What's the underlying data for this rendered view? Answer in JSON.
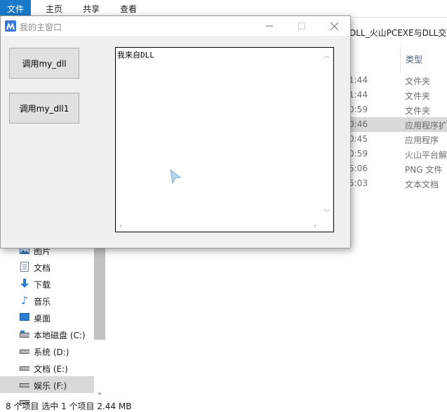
{
  "explorer": {
    "ribbon_tabs": [
      "文件",
      "主页",
      "共享",
      "查看"
    ],
    "address_text": "DLL_火山PCEXE与DLL交互",
    "column_header": "类型",
    "files": [
      {
        "time": "1:44",
        "type": "文件夹"
      },
      {
        "time": "1:44",
        "type": "文件夹"
      },
      {
        "time": "0:59",
        "type": "文件夹"
      },
      {
        "time": "0:46",
        "type": "应用程序扩",
        "selected": true
      },
      {
        "time": "0:45",
        "type": "应用程序"
      },
      {
        "time": "0:59",
        "type": "火山平台解"
      },
      {
        "time": "5:06",
        "type": "PNG 文件"
      },
      {
        "time": "5:03",
        "type": "文本文档"
      }
    ],
    "nav_items": [
      {
        "label": "图片",
        "icon": "pictures-icon"
      },
      {
        "label": "文档",
        "icon": "documents-icon"
      },
      {
        "label": "下载",
        "icon": "download-icon"
      },
      {
        "label": "音乐",
        "icon": "music-icon"
      },
      {
        "label": "桌面",
        "icon": "desktop-icon"
      },
      {
        "label": "本地磁盘 (C:)",
        "icon": "drive-icon"
      },
      {
        "label": "系统 (D:)",
        "icon": "drive-icon"
      },
      {
        "label": "文档 (E:)",
        "icon": "drive-icon"
      },
      {
        "label": "娱乐 (F:)",
        "icon": "drive-icon",
        "selected": true
      },
      {
        "label": "",
        "icon": "drive-icon"
      }
    ],
    "status_text": "8 个项目    选中 1 个项目  2.44 MB"
  },
  "window": {
    "title": "我的主窗口",
    "button1_label": "调用my_dll",
    "button2_label": "调用my_dll1",
    "textbox_content": "我来自DLL"
  },
  "colors": {
    "ribbon_file_tab": "#1979ca",
    "selection": "#d9d9d9",
    "window_bg": "#f0f0f0",
    "app_icon": "#3b78d8"
  }
}
